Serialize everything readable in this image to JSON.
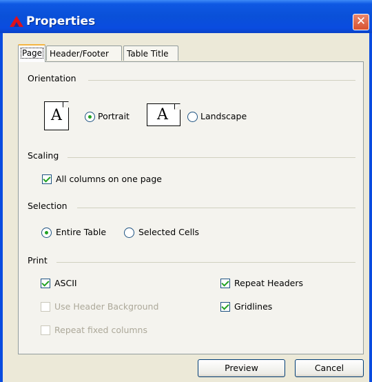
{
  "window": {
    "title": "Properties",
    "app_icon": "red-triangle-icon",
    "close_icon": "close-icon"
  },
  "tabs": [
    {
      "label": "Page",
      "active": true
    },
    {
      "label": "Header/Footer",
      "active": false
    },
    {
      "label": "Table Title",
      "active": false
    }
  ],
  "orientation": {
    "label": "Orientation",
    "portrait": "Portrait",
    "landscape": "Landscape",
    "selected": "Portrait",
    "page_letter": "A"
  },
  "scaling": {
    "label": "Scaling",
    "all_columns": "All columns on one page",
    "all_columns_checked": true
  },
  "selection": {
    "label": "Selection",
    "entire_table": "Entire Table",
    "selected_cells": "Selected Cells",
    "selected": "Entire Table"
  },
  "print": {
    "label": "Print",
    "ascii": "ASCII",
    "ascii_checked": true,
    "use_header_background": "Use Header Background",
    "use_header_background_enabled": false,
    "repeat_fixed_columns": "Repeat fixed columns",
    "repeat_fixed_columns_enabled": false,
    "repeat_headers": "Repeat Headers",
    "repeat_headers_checked": true,
    "gridlines": "Gridlines",
    "gridlines_checked": true
  },
  "buttons": {
    "preview": "Preview",
    "cancel": "Cancel"
  },
  "colors": {
    "titlebar": "#0a4ce0",
    "check_mark": "#21a121",
    "close": "#d8522f"
  }
}
